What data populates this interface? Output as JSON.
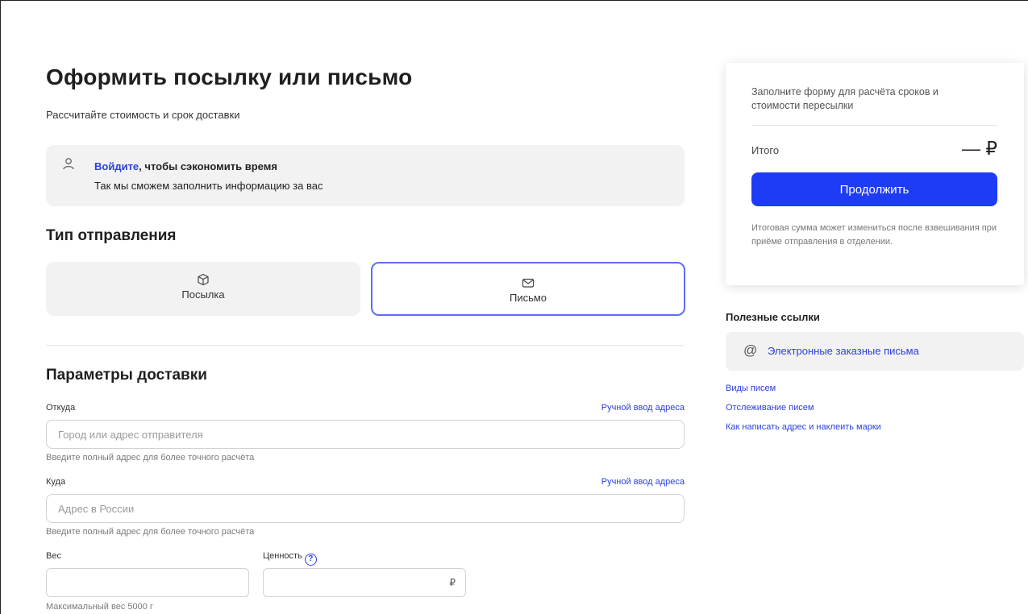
{
  "header": {
    "title": "Оформить посылку или письмо",
    "subtitle": "Рассчитайте стоимость и срок доставки"
  },
  "login_banner": {
    "icon": "user-icon",
    "link_text": "Войдите",
    "line1_rest": ", чтобы сэкономить время",
    "line2": "Так мы сможем заполнить информацию за вас"
  },
  "shipment_type": {
    "title": "Тип отправления",
    "options": [
      {
        "label": "Посылка",
        "icon": "box-icon",
        "selected": false
      },
      {
        "label": "Письмо",
        "icon": "envelope-icon",
        "selected": true
      }
    ]
  },
  "delivery_params": {
    "title": "Параметры доставки",
    "from": {
      "label": "Откуда",
      "manual_link": "Ручной ввод адреса",
      "placeholder": "Город или адрес отправителя",
      "value": "",
      "hint": "Введите полный адрес для более точного расчёта"
    },
    "to": {
      "label": "Куда",
      "manual_link": "Ручной ввод адреса",
      "placeholder": "Адрес в России",
      "value": "",
      "hint": "Введите полный адрес для более точного расчёта"
    },
    "weight": {
      "label": "Вес",
      "value": "",
      "hint": "Максимальный вес 5000 г"
    },
    "declared_value": {
      "label": "Ценность",
      "help_icon": "?",
      "suffix": "₽",
      "value": ""
    }
  },
  "summary": {
    "note": "Заполните форму для расчёта сроков и стоимости пересылки",
    "total_label": "Итого",
    "total_value": "— ₽",
    "continue_label": "Продолжить",
    "disclaimer": "Итоговая сумма может измениться после взвешивания при приёме отправления в отделении."
  },
  "useful_links": {
    "title": "Полезные ссылки",
    "featured": {
      "icon": "at-icon",
      "label": "Электронные заказные письма"
    },
    "links": [
      "Виды писем",
      "Отслеживание писем",
      "Как написать адрес и наклеить марки"
    ]
  },
  "colors": {
    "accent": "#1e3cf5",
    "link": "#2a3fdc",
    "selected_border": "#5a6ef5",
    "panel_bg": "#f2f2f2"
  }
}
